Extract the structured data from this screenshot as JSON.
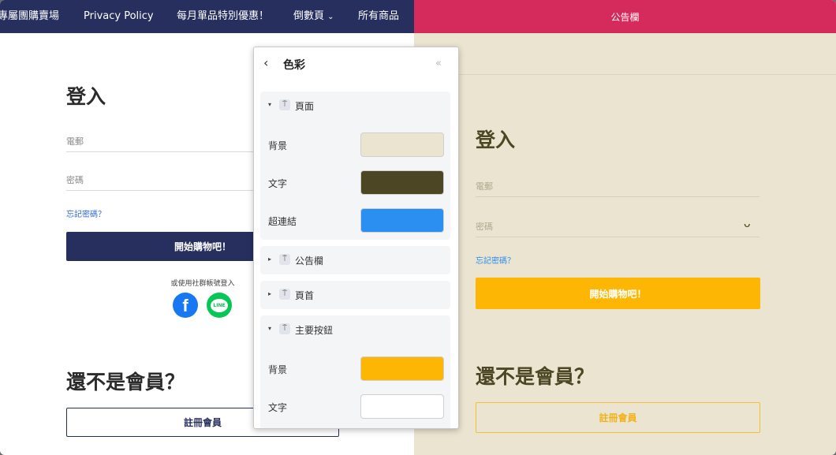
{
  "left_page": {
    "nav": {
      "items": [
        "專屬團購賣場",
        "Privacy Policy",
        "每月單品特別優惠！",
        "倒數頁",
        "所有商品"
      ],
      "dropdown_caret": "⌄"
    },
    "login_title": "登入",
    "email_label": "電郵",
    "password_label": "密碼",
    "forgot_password": "忘記密碼？",
    "shop_button": "開始購物吧！",
    "social_login_text": "或使用社群帳號登入",
    "facebook_glyph": "f",
    "line_glyph": "LINE",
    "not_member_title": "還不是會員？",
    "register_button": "註冊會員"
  },
  "right_page": {
    "announcement_bar": "公告欄",
    "login_title": "登入",
    "email_label": "電郵",
    "password_label": "密碼",
    "eye_glyph": "ᴗ",
    "forgot_password": "忘記密碼？",
    "shop_button": "開始購物吧！",
    "not_member_title": "還不是會員？",
    "register_button": "註冊會員"
  },
  "color_panel": {
    "back_glyph": "‹",
    "title": "色彩",
    "collapse_glyph": "«",
    "expanded_glyph": "▾",
    "collapsed_glyph": "▸",
    "group_icon_glyph": "⍑",
    "groups": [
      {
        "label": "頁面",
        "expanded": true,
        "rows": [
          {
            "label": "背景",
            "color": "#ebe4d0"
          },
          {
            "label": "文字",
            "color": "#4d4625"
          },
          {
            "label": "超連結",
            "color": "#2b8ff2"
          }
        ]
      },
      {
        "label": "公告欄",
        "expanded": false
      },
      {
        "label": "頁首",
        "expanded": false
      },
      {
        "label": "主要按鈕",
        "expanded": true,
        "rows": [
          {
            "label": "背景",
            "color": "#fdb603"
          },
          {
            "label": "文字",
            "color": "#ffffff"
          }
        ]
      }
    ]
  },
  "colors": {
    "left_nav": "#262f5e",
    "announcement": "#d42a5c",
    "right_bg": "#ebe4d0",
    "right_text": "#4d4625",
    "primary_button": "#fdb603"
  }
}
